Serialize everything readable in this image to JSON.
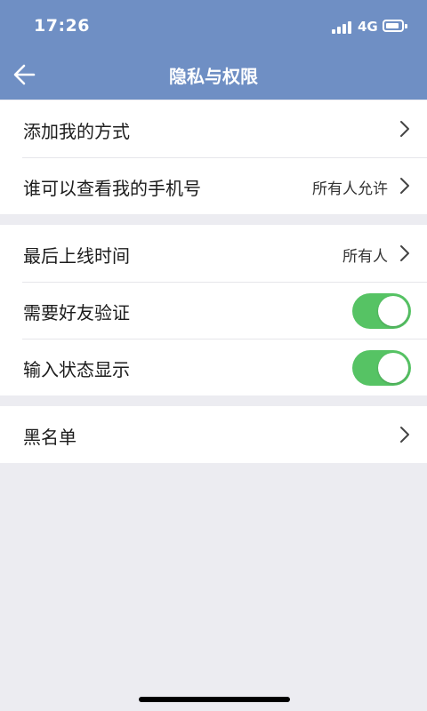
{
  "status_bar": {
    "time": "17:26",
    "network": "4G"
  },
  "nav": {
    "title": "隐私与权限",
    "back_icon": "arrow-left-icon"
  },
  "groups": [
    {
      "items": [
        {
          "label": "添加我的方式",
          "value": "",
          "control": "chevron"
        },
        {
          "label": "谁可以查看我的手机号",
          "value": "所有人允许",
          "control": "chevron"
        }
      ]
    },
    {
      "items": [
        {
          "label": "最后上线时间",
          "value": "所有人",
          "control": "chevron"
        },
        {
          "label": "需要好友验证",
          "control": "toggle",
          "on": true
        },
        {
          "label": "输入状态显示",
          "control": "toggle",
          "on": true
        }
      ]
    },
    {
      "items": [
        {
          "label": "黑名单",
          "value": "",
          "control": "chevron"
        }
      ]
    }
  ],
  "colors": {
    "header_bg": "#6f8fc4",
    "toggle_on": "#56c364",
    "page_bg": "#ececf1"
  }
}
